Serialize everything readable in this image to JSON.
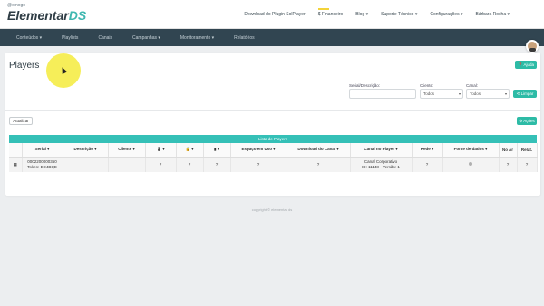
{
  "header": {
    "logo_small": "@oinogo",
    "logo_main": "Elementar",
    "logo_accent": "DS",
    "links": [
      {
        "label": "Download do Plugin SolPlayer"
      },
      {
        "label": "$ Financeiro"
      },
      {
        "label": "Blog ▾"
      },
      {
        "label": "Suporte Técnico ▾"
      },
      {
        "label": "Configurações ▾"
      },
      {
        "label": "Bárbara Rocha ▾"
      }
    ]
  },
  "nav": {
    "items": [
      {
        "label": "Conteúdos ▾"
      },
      {
        "label": "Playlists"
      },
      {
        "label": "Canais"
      },
      {
        "label": "Campanhas ▾"
      },
      {
        "label": "Monitoramento ▾"
      },
      {
        "label": "Relatórios"
      }
    ]
  },
  "page": {
    "title": "Players",
    "help_label": "❓ Ajuda",
    "filters": {
      "serial_label": "Serial/Descrição:",
      "serial_value": "",
      "cliente_label": "Cliente:",
      "cliente_value": "Todos",
      "canal_label": "Canal:",
      "canal_value": "Todos",
      "clear_label": "⟲ Limpar"
    },
    "refresh_label": "Atualizar",
    "actions_label": "⚙ Ações"
  },
  "table": {
    "title": "Lista de Players",
    "headers": [
      "",
      "Serial ▾",
      "Descrição ▾",
      "Cliente ▾",
      "🌡 ▾",
      "🔒 ▾",
      "▮ ▾",
      "Espaço em Uso ▾",
      "Download do Canal ▾",
      "Canal no Player ▾",
      "Rede ▾",
      "Fonte de dados ▾",
      "No Ar",
      "Relat."
    ],
    "rows": [
      {
        "check": "▦",
        "serial_line1": "0002200000350",
        "serial_line2": "Token: ED4BQE",
        "descricao": "",
        "cliente": "",
        "temp": "?",
        "lock": "?",
        "bat": "?",
        "espaco": "?",
        "download": "?",
        "canal_line1": "Canal Corporativo",
        "canal_line2": "ID: 11148 · Versão: 1",
        "rede": "?",
        "fonte": "",
        "no_ar": "?",
        "relat": "?"
      }
    ]
  },
  "footer": {
    "text": "copyright © elementar ds"
  },
  "colors": {
    "accent": "#2dbba6",
    "nav_bg": "#314551",
    "table_title_bg": "#35c0b7",
    "highlight": "#f4eb3c"
  }
}
